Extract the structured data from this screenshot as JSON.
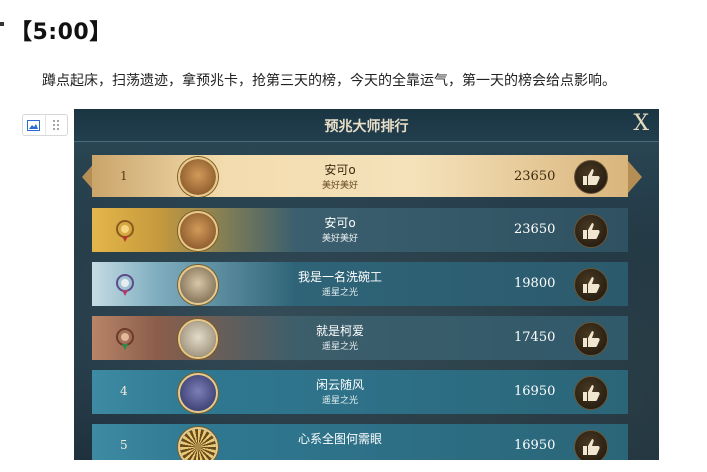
{
  "article": {
    "heading": "【5:00】",
    "paragraph": "蹲点起床，扫荡遗迹，拿预兆卡，抢第三天的榜，今天的全靠运气，第一天的榜会给点影响。"
  },
  "image_toolbar": {
    "icons": [
      "image-icon",
      "drag-handle-icon"
    ]
  },
  "leaderboard": {
    "title": "预兆大师排行",
    "close_label": "X",
    "my_rank": {
      "rank": "1",
      "name": "安可o",
      "guild": "美好美好",
      "score": "23650"
    },
    "rows": [
      {
        "medal": "gold",
        "name": "安可o",
        "guild": "美好美好",
        "score": "23650"
      },
      {
        "medal": "silver",
        "name": "我是一名洗碗工",
        "guild": "遥星之光",
        "score": "19800"
      },
      {
        "medal": "bronze",
        "name": "就是柯爱",
        "guild": "遥星之光",
        "score": "17450"
      },
      {
        "rank": "4",
        "name": "闲云随风",
        "guild": "遥星之光",
        "score": "16950"
      },
      {
        "rank": "5",
        "name": "心系全图何需眼",
        "guild": "",
        "score": "16950"
      }
    ],
    "colors": {
      "gold": "#e4b64a",
      "silver": "#c5dbe4",
      "bronze": "#b98468",
      "panel": "#1f3542"
    }
  }
}
